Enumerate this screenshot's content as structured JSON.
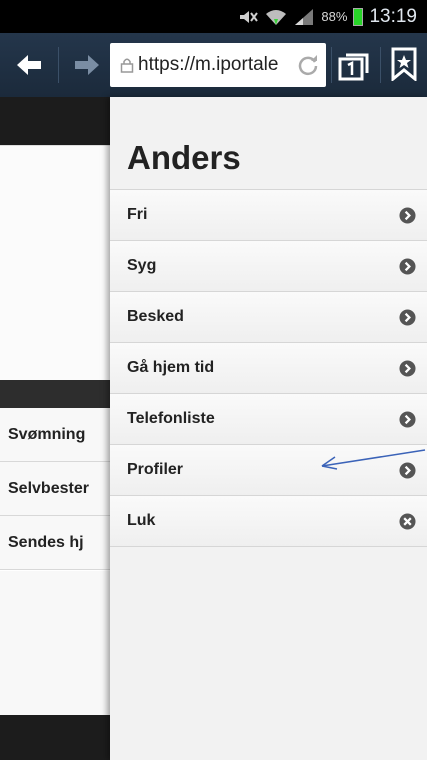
{
  "status_bar": {
    "battery_percent": "88%",
    "time": "13:19",
    "icons": [
      "mute-icon",
      "wifi-icon",
      "signal-icon",
      "battery-icon"
    ]
  },
  "browser": {
    "url": "https://m.iportale",
    "icons": [
      "back-arrow-icon",
      "forward-arrow-icon",
      "lock-icon",
      "reload-icon",
      "tabs-icon",
      "bookmark-icon"
    ]
  },
  "background_page": {
    "list": [
      {
        "label": "Svømning"
      },
      {
        "label": "Selvbester"
      },
      {
        "label": "Sendes hj"
      }
    ]
  },
  "panel": {
    "title": "Anders",
    "items": [
      {
        "label": "Fri",
        "icon": "chevron-right-circle-icon"
      },
      {
        "label": "Syg",
        "icon": "chevron-right-circle-icon"
      },
      {
        "label": "Besked",
        "icon": "chevron-right-circle-icon"
      },
      {
        "label": "Gå hjem tid",
        "icon": "chevron-right-circle-icon"
      },
      {
        "label": "Telefonliste",
        "icon": "chevron-right-circle-icon"
      },
      {
        "label": "Profiler",
        "icon": "chevron-right-circle-icon"
      },
      {
        "label": "Luk",
        "icon": "close-circle-icon"
      }
    ]
  },
  "colors": {
    "toolbar": "#1f3044",
    "panel_bg": "#f2f2f2",
    "icon_fill": "#555555",
    "annotation_arrow": "#3b63b8",
    "battery": "#28d428"
  }
}
